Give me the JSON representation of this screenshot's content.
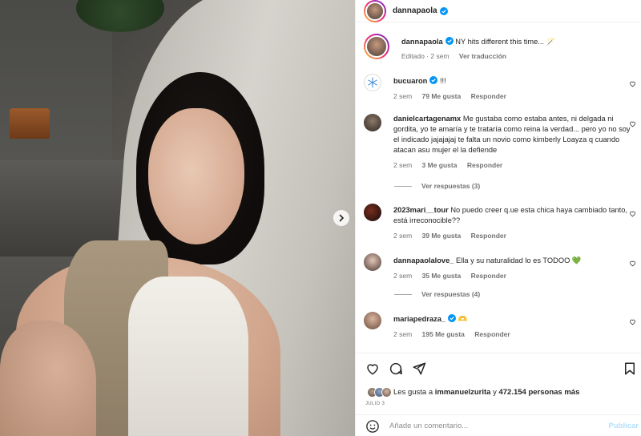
{
  "post": {
    "author": "dannapaola",
    "caption_user": "dannapaola",
    "caption": "NY hits different this time... 🪄",
    "edited": "Editado · 2 sem",
    "translate": "Ver traducción"
  },
  "comments": [
    {
      "user": "bucuaron",
      "verified": true,
      "text": "!!!",
      "age": "2 sem",
      "likes": "79 Me gusta",
      "reply": "Responder"
    },
    {
      "user": "danielcartagenamx",
      "verified": false,
      "text": "Me gustaba como estaba antes, ni delgada ni gordita, yo te amaría y te trataría como reina la verdad... pero yo no soy el indicado jajajajaj te falta un novio como kimberly Loayza q cuando atacan asu mujer el la defiende",
      "age": "2 sem",
      "likes": "3 Me gusta",
      "reply": "Responder",
      "view_replies": "Ver respuestas (3)"
    },
    {
      "user": "2023mari__tour",
      "verified": false,
      "text": "No puedo creer q.ue esta chica haya cambiado tanto, está irreconocible??",
      "age": "2 sem",
      "likes": "39 Me gusta",
      "reply": "Responder"
    },
    {
      "user": "dannapaolalove_",
      "verified": false,
      "text": "Ella y su naturalidad lo es TODOO 💚",
      "age": "2 sem",
      "likes": "35 Me gusta",
      "reply": "Responder",
      "view_replies": "Ver respuestas (4)"
    },
    {
      "user": "mariapedraza_",
      "verified": true,
      "text": "🫶",
      "age": "2 sem",
      "likes": "195 Me gusta",
      "reply": "Responder"
    }
  ],
  "likes": {
    "prefix": "Les gusta a",
    "user": "immanuelzurita",
    "connector": "y",
    "count": "472.154 personas más"
  },
  "date": "JULIO 3",
  "add_comment": {
    "placeholder": "Añade un comentario...",
    "publish": "Publicar"
  },
  "colors": {
    "verified": "#0095f6",
    "link": "#b2dffc",
    "heart_green": "#2ecc71"
  },
  "icons": [
    "heart-icon",
    "comment-icon",
    "share-icon",
    "save-icon",
    "emoji-icon",
    "next-arrow-icon"
  ]
}
